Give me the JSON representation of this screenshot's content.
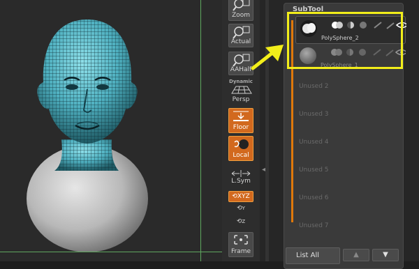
{
  "toolbar": {
    "zoom_label": "Zoom",
    "actual_label": "Actual",
    "aahalf_label": "AAHalf",
    "dynamic_label": "Dynamic",
    "persp_label": "Persp",
    "floor_label": "Floor",
    "local_label": "Local",
    "lsym_label": "L.Sym",
    "xyz_label": "XYZ",
    "y_label": "Y",
    "z_label": "Z",
    "frame_label": "Frame"
  },
  "subtool": {
    "title": "SubTool",
    "items": [
      {
        "name": "PolySphere_2",
        "selected": true
      },
      {
        "name": "PolySphere_1",
        "selected": false
      }
    ],
    "unused": [
      "Unused 2",
      "Unused 3",
      "Unused 4",
      "Unused 5",
      "Unused 6",
      "Unused 7"
    ],
    "list_all_label": "List All"
  },
  "colors": {
    "highlight": "#f2ee1a",
    "accent_orange": "#d2691e",
    "mesh": "#4fb0c0"
  }
}
